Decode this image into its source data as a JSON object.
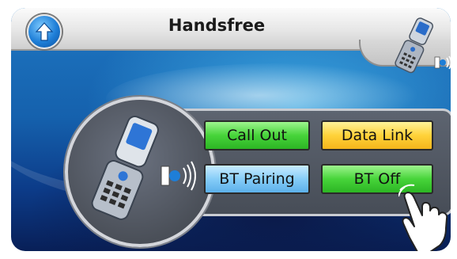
{
  "header": {
    "title": "Handsfree",
    "up_icon": "up-arrow-icon",
    "corner_icon": "bluetooth-phone-icon"
  },
  "main": {
    "hero_icon": "bluetooth-phone-icon",
    "buttons": [
      {
        "label": "Call Out",
        "color": "#47d43a"
      },
      {
        "label": "Data Link",
        "color": "#ffd23a"
      },
      {
        "label": "BT Pairing",
        "color": "#86cdf8"
      },
      {
        "label": "BT Off",
        "color": "#47d43a"
      }
    ]
  },
  "pointer_icon": "tapping-hand-icon"
}
